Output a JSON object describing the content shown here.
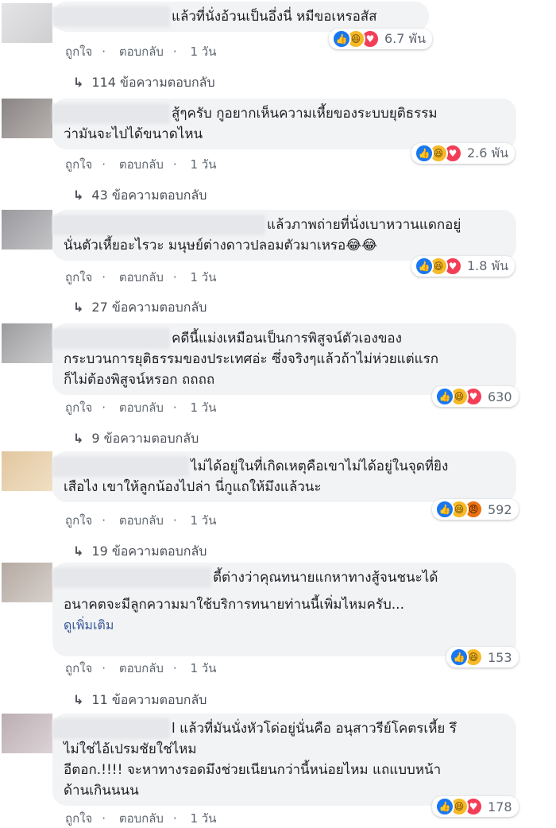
{
  "actions": {
    "like": "ถูกใจ",
    "reply": "ตอบกลับ",
    "time": "1 วัน",
    "sep": "·"
  },
  "reply_arrow": "↳",
  "comments": [
    {
      "lines": [
        "แล้วที่นั่งอ้วนเป็นอึ่งนี่ หมีขอเหรอสัส"
      ],
      "reactions": [
        "like",
        "haha",
        "love"
      ],
      "count": "6.7 พัน",
      "replies": "114 ข้อความตอบกลับ"
    },
    {
      "lines": [
        "สู้ๆครับ กูอยากเห็นความเหี้ยของระบบยุติธรรม",
        "ว่ามันจะไปได้ขนาดไหน"
      ],
      "reactions": [
        "like",
        "haha",
        "love"
      ],
      "count": "2.6 พัน",
      "replies": "43 ข้อความตอบกลับ"
    },
    {
      "lines": [
        "แล้วภาพถ่ายที่นั่งเบาหวานแดกอยู่",
        "นั่นตัวเหี้ยอะไรวะ มนุษย์ต่างดาวปลอมตัวมาเหรอ😂😂"
      ],
      "reactions": [
        "like",
        "haha",
        "love"
      ],
      "count": "1.8 พัน",
      "replies": "27 ข้อความตอบกลับ"
    },
    {
      "lines": [
        "คดีนี้แม่งเหมือนเป็นการพิสูจน์ตัวเองของ",
        "กระบวนการยุติธรรมของประเทศอ่ะ ซึ่งจริงๆแล้วถ้าไม่ห่วยแต่แรก",
        "ก็ไม่ต้องพิสูจน์หรอก ถถถถ"
      ],
      "reactions": [
        "like",
        "haha",
        "love"
      ],
      "count": "630",
      "replies": "9 ข้อความตอบกลับ"
    },
    {
      "lines": [
        "ไม่ได้อยู่ในที่เกิดเหตุคือเขาไม่ได้อยู่ในจุดที่ยิง",
        "เสือไง เขาให้ลูกน้องไปล่า นี่กูแถให้มึงแล้วนะ"
      ],
      "reactions": [
        "like",
        "haha",
        "angry"
      ],
      "count": "592",
      "replies": "19 ข้อความตอบกลับ"
    },
    {
      "lines": [
        "ตี้ต่างว่าคุณทนายแกหาทางสู้จนชนะได้",
        "อนาคตจะมีลูกความมาใช้บริการทนายท่านนี้เพิ่มไหมครับ..."
      ],
      "see_more": "ดูเพิ่มเติม",
      "reactions": [
        "like",
        "haha"
      ],
      "count": "153",
      "replies": "11 ข้อความตอบกลับ"
    },
    {
      "lines": [
        "l แล้วที่มันนั่งหัวโด่อยู่นั่นคือ อนุสาวรีย์โคตรเหี้ย รึ",
        "ไม่ใช่ไอ้เปรมชัยใช่ไหม",
        "อีตอก.!!!! จะหาทางรอดมึงช่วยเนียนกว่านี้หน่อยไหม แถแบบหน้า",
        "ด้านเกินนนน"
      ],
      "reactions": [
        "like",
        "haha",
        "love"
      ],
      "count": "178",
      "replies": ""
    }
  ],
  "icons": {
    "like": "like-reaction-icon",
    "haha": "haha-reaction-icon",
    "love": "love-reaction-icon",
    "angry": "angry-reaction-icon"
  }
}
